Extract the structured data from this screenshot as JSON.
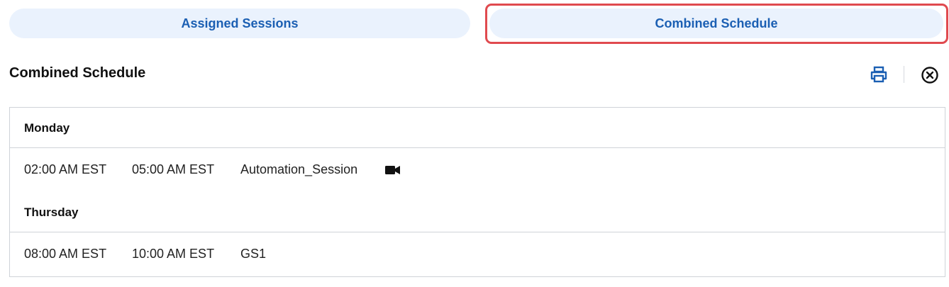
{
  "tabs": {
    "assigned_label": "Assigned Sessions",
    "combined_label": "Combined Schedule"
  },
  "section": {
    "title": "Combined Schedule"
  },
  "actions": {
    "print_icon": "print-icon",
    "close_icon": "close-circle-icon"
  },
  "schedule": {
    "days": [
      {
        "label": "Monday",
        "sessions": [
          {
            "start": "02:00 AM EST",
            "end": "05:00 AM EST",
            "name": "Automation_Session",
            "icon": "video-camera-icon"
          }
        ]
      },
      {
        "label": "Thursday",
        "sessions": [
          {
            "start": "08:00 AM EST",
            "end": "10:00 AM EST",
            "name": "GS1"
          }
        ]
      }
    ]
  },
  "colors": {
    "tab_bg": "#eaf2fd",
    "tab_text": "#1b5fb3",
    "highlight": "#e04a4f",
    "border": "#cfd3d8"
  }
}
